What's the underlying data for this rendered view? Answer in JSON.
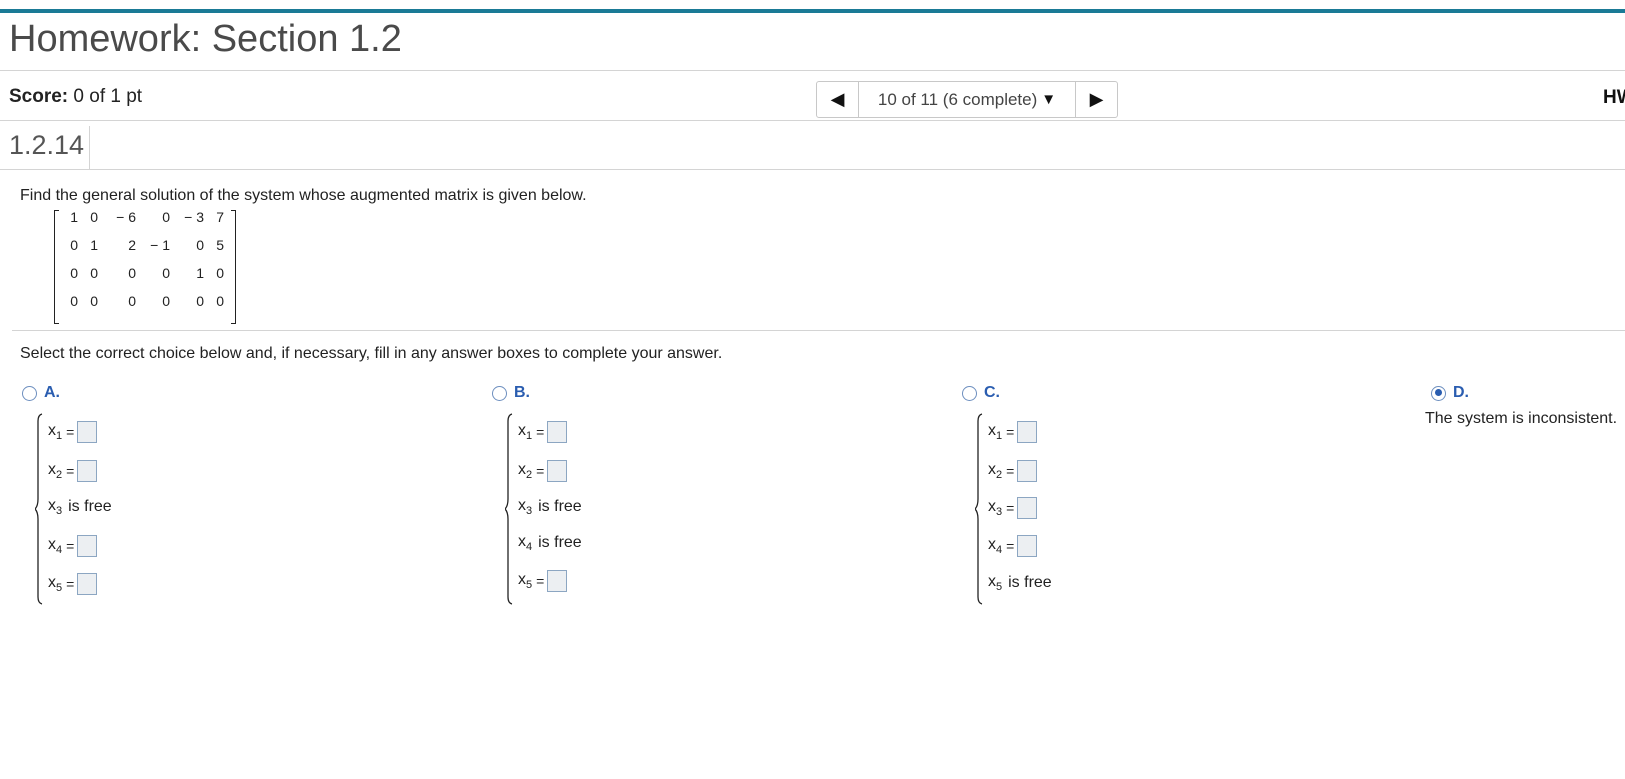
{
  "header": {
    "title": "Homework: Section 1.2"
  },
  "score": {
    "label": "Score:",
    "value": "0 of 1 pt"
  },
  "nav": {
    "prev_icon": "triangle-left-icon",
    "position": "10 of 11 (6 complete)",
    "dropdown_icon": "caret-down-icon",
    "next_icon": "triangle-right-icon"
  },
  "right_label": "HW",
  "question": {
    "number": "1.2.14",
    "prompt": "Find the general solution of the system whose augmented matrix is given below.",
    "matrix": [
      [
        "1",
        "0",
        "− 6",
        "0",
        "− 3",
        "7"
      ],
      [
        "0",
        "1",
        "2",
        "− 1",
        "0",
        "5"
      ],
      [
        "0",
        "0",
        "0",
        "0",
        "1",
        "0"
      ],
      [
        "0",
        "0",
        "0",
        "0",
        "0",
        "0"
      ]
    ],
    "instruction": "Select the correct choice below and, if necessary, fill in any answer boxes to complete your answer."
  },
  "choices": {
    "a": {
      "label": "A.",
      "selected": false,
      "rows": [
        {
          "sub": "1",
          "type": "box"
        },
        {
          "sub": "2",
          "type": "box"
        },
        {
          "sub": "3",
          "type": "free",
          "text": "is free"
        },
        {
          "sub": "4",
          "type": "box"
        },
        {
          "sub": "5",
          "type": "box"
        }
      ]
    },
    "b": {
      "label": "B.",
      "selected": false,
      "rows": [
        {
          "sub": "1",
          "type": "box"
        },
        {
          "sub": "2",
          "type": "box"
        },
        {
          "sub": "3",
          "type": "free",
          "text": "is free"
        },
        {
          "sub": "4",
          "type": "free",
          "text": "is free"
        },
        {
          "sub": "5",
          "type": "box"
        }
      ]
    },
    "c": {
      "label": "C.",
      "selected": false,
      "rows": [
        {
          "sub": "1",
          "type": "box"
        },
        {
          "sub": "2",
          "type": "box"
        },
        {
          "sub": "3",
          "type": "box"
        },
        {
          "sub": "4",
          "type": "box"
        },
        {
          "sub": "5",
          "type": "free",
          "text": "is free"
        }
      ]
    },
    "d": {
      "label": "D.",
      "selected": true,
      "text": "The system is inconsistent."
    }
  },
  "variable_letter": "x",
  "equals_sign": "=",
  "colors": {
    "accent_bar": "#1a7a96",
    "choice_label": "#2a5db0"
  }
}
